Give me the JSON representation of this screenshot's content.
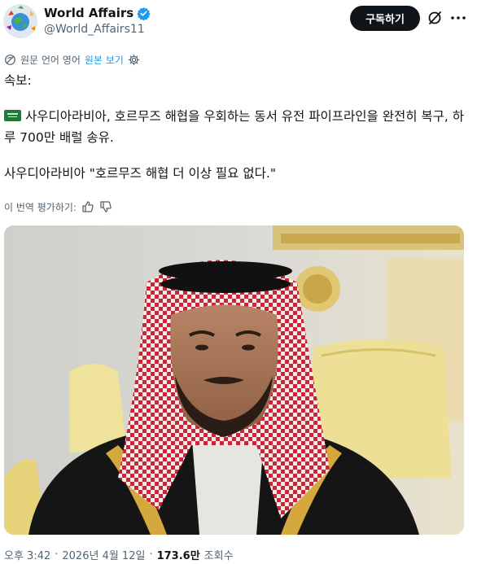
{
  "author": {
    "display_name": "World Affairs",
    "handle": "@World_Affairs11",
    "avatar_icon": "globe-hands-avatar",
    "verified_icon": "verified-badge-icon"
  },
  "actions": {
    "subscribe_label": "구독하기",
    "grok_icon": "grok-icon",
    "more_icon": "more-icon"
  },
  "translation": {
    "source_text": "원문 언어 영어",
    "show_original": "원본 보기",
    "translate_icon": "translate-icon",
    "settings_icon": "gear-icon"
  },
  "tweet": {
    "line1": "속보:",
    "flag_icon": "saudi-flag-icon",
    "line2": "사우디아라비아, 호르무즈 해협을 우회하는 동서 유전 파이프라인을 완전히 복구, 하루 700만 배럴 송유.",
    "line3": "사우디아라비아 \"호르무즈 해협 더 이상 필요 없다.\""
  },
  "rating": {
    "label": "이 번역 평가하기:",
    "like_icon": "thumbs-up-icon",
    "dislike_icon": "thumbs-down-icon"
  },
  "meta": {
    "time": "오후 3:42",
    "date": "2026년 4월 12일",
    "separator": "·",
    "views_count": "173.6만",
    "views_label": "조회수"
  },
  "colors": {
    "link": "#1d9bf0",
    "text": "#0f1419",
    "secondary": "#536471",
    "button_bg": "#0f1419",
    "verified": "#1d9bf0"
  }
}
